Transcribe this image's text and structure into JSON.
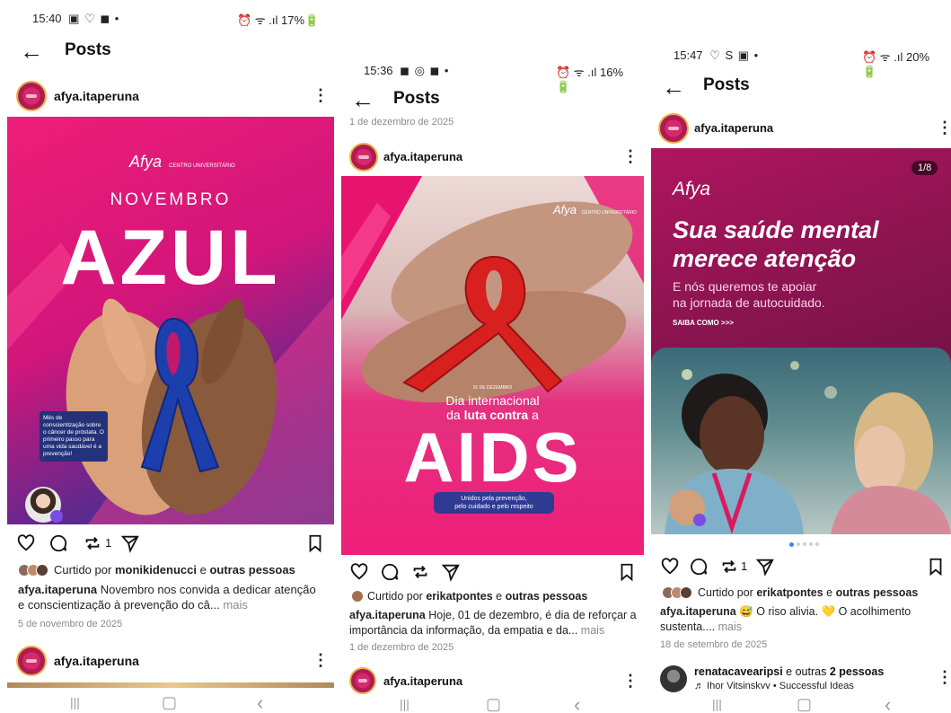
{
  "screens": [
    {
      "status": {
        "time": "15:40",
        "icons_left": "▣ ♡ ◼ •",
        "icons_right": "⏰ ᯤ .ıl 17%🔋"
      },
      "header": {
        "title": "Posts"
      },
      "post": {
        "handle": "afya.itaperuna",
        "image": {
          "brand": "Afya",
          "brand_sub": "CENTRO UNIVERSITÁRIO",
          "kicker": "NOVEMBRO",
          "headline": "AZUL",
          "note": "Mês de conscientização sobre o câncer de próstata. O primeiro passo para uma vida saudável é a prevenção!"
        },
        "repost_count": "1",
        "liked_prefix": "Curtido por",
        "liked_user": "monikidenucci",
        "liked_join": "e",
        "liked_others": "outras pessoas",
        "caption_handle": "afya.itaperuna",
        "caption_text": "Novembro nos convida a dedicar atenção e conscientização à prevenção do câ...",
        "more": "mais",
        "date": "5 de novembro de 2025"
      },
      "next_post": {
        "handle": "afya.itaperuna"
      }
    },
    {
      "status": {
        "time": "15:36",
        "icons_left": "◼ ◎ ◼ •",
        "icons_right": "⏰ ᯤ .ıl 16%🔋"
      },
      "header": {
        "title": "Posts"
      },
      "top_date": "1 de dezembro de 2025",
      "post": {
        "handle": "afya.itaperuna",
        "image": {
          "brand": "Afya",
          "brand_sub": "CENTRO UNIVERSITÁRIO",
          "small_date": "01 DE DEZEMBRO",
          "line1": "Dia internacional",
          "line2_pre": "da",
          "line2_bold": "luta contra",
          "line2_post": "a",
          "headline": "AIDS",
          "pill1": "Unidos pela prevenção,",
          "pill2": "pelo cuidado e pelo respeito"
        },
        "liked_prefix": "Curtido por",
        "liked_user": "erikatpontes",
        "liked_join": "e",
        "liked_others": "outras pessoas",
        "caption_handle": "afya.itaperuna",
        "caption_text": "Hoje, 01 de dezembro, é dia de reforçar a importância da informação, da empatia e da...",
        "more": "mais",
        "date": "1 de dezembro de 2025"
      },
      "next_post": {
        "handle": "afya.itaperuna"
      }
    },
    {
      "status": {
        "time": "15:47",
        "icons_left": "♡ S ▣ •",
        "icons_right": "⏰ ᯤ .ıl 20%🔋"
      },
      "header": {
        "title": "Posts"
      },
      "post": {
        "handle": "afya.itaperuna",
        "image": {
          "counter": "1/8",
          "brand": "Afya",
          "headline1": "Sua saúde mental",
          "headline2": "merece atenção",
          "sub1": "E nós queremos te apoiar",
          "sub2": "na jornada de autocuidado.",
          "cta": "SAIBA COMO >>>"
        },
        "repost_count": "1",
        "liked_prefix": "Curtido por",
        "liked_user": "erikatpontes",
        "liked_join": "e",
        "liked_others": "outras pessoas",
        "caption_handle": "afya.itaperuna",
        "caption_text": "😅 O riso alivia. 💛 O acolhimento sustenta....",
        "more": "mais",
        "date": "18 de setembro de 2025"
      },
      "next_post": {
        "handle": "renatacavearipsi",
        "handle_suffix": "e outras",
        "others_count": "2 pessoas",
        "music": "♬ Ihor Vitsinskyy • Successful Ideas"
      }
    }
  ],
  "nav": {
    "recent": "|||",
    "home": "▢",
    "back": "‹"
  },
  "colors": {
    "pink": "#e8136f",
    "magenta": "#c2186b",
    "navy": "#24327a",
    "blue": "#1f4bb0",
    "gray_text": "#8a8a8a"
  }
}
